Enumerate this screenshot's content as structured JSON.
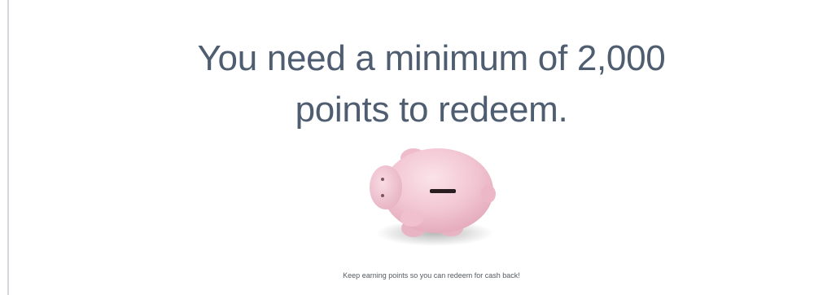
{
  "message": {
    "headline": "You need a minimum of 2,000 points to redeem.",
    "caption": "Keep earning points so you can redeem for cash back!"
  },
  "colors": {
    "headline_text": "#4e5d70",
    "piggy_pink": "#f2c6d3"
  },
  "icons": {
    "illustration": "piggy-bank-icon"
  }
}
